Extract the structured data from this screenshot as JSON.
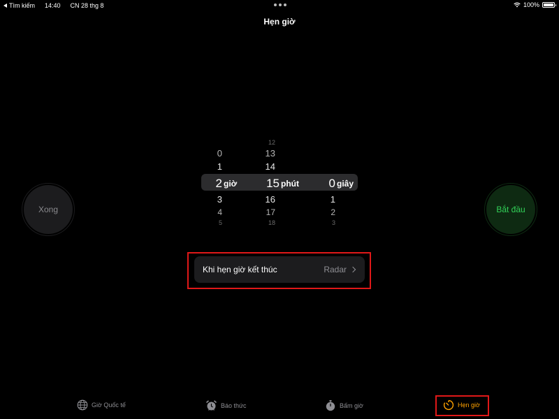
{
  "status_bar": {
    "back_label": "Tìm kiếm",
    "time": "14:40",
    "date": "CN 28 thg 8",
    "battery": "100%"
  },
  "title": "Hẹn giờ",
  "buttons": {
    "cancel": "Xong",
    "start": "Bắt đầu"
  },
  "picker": {
    "hours": {
      "above": [
        "0",
        "1"
      ],
      "selected": "2",
      "below": [
        "3",
        "4",
        "5"
      ],
      "unit": "giờ"
    },
    "minutes": {
      "above": [
        "12",
        "13",
        "14"
      ],
      "selected": "15",
      "below": [
        "16",
        "17",
        "18"
      ],
      "unit": "phút"
    },
    "seconds": {
      "selected": "0",
      "below": [
        "1",
        "2",
        "3"
      ],
      "unit": "giây"
    }
  },
  "when_timer_ends": {
    "label": "Khi hẹn giờ kết thúc",
    "value": "Radar"
  },
  "tab_bar": {
    "tabs": [
      {
        "label": "Giờ Quốc tế",
        "icon": "globe-icon"
      },
      {
        "label": "Báo thức",
        "icon": "alarm-clock-icon"
      },
      {
        "label": "Bấm giờ",
        "icon": "stopwatch-icon"
      },
      {
        "label": "Hẹn giờ",
        "icon": "timer-icon",
        "active": true
      }
    ]
  },
  "colors": {
    "accent": "#ffa200",
    "start_green": "#32d158",
    "annotation_red": "#e01818"
  }
}
